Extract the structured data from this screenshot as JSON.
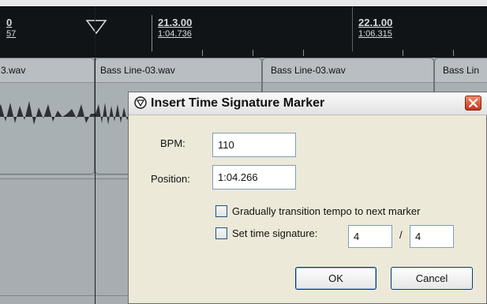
{
  "ruler": {
    "left_bar": "0",
    "left_time": "57",
    "marker1_bar": "21.3.00",
    "marker1_time": "1:04.736",
    "marker2_bar": "22.1.00",
    "marker2_time": "1:06.315"
  },
  "clips": [
    {
      "name": "3.wav"
    },
    {
      "name": "Bass Line-03.wav"
    },
    {
      "name": "Bass Line-03.wav"
    },
    {
      "name": "Bass Lin"
    }
  ],
  "dialog": {
    "title": "Insert Time Signature Marker",
    "bpm_label": "BPM:",
    "bpm_value": "110",
    "position_label": "Position:",
    "position_value": "1:04.266",
    "gradual_label": "Gradually transition tempo to next marker",
    "set_timesig_label": "Set time signature:",
    "timesig_numerator": "4",
    "timesig_separator": "/",
    "timesig_denominator": "4",
    "ok_label": "OK",
    "cancel_label": "Cancel"
  },
  "icons": {
    "dialog_app": "reaper-logo-icon",
    "close": "close-icon",
    "playhead": "playhead-triangle-icon"
  },
  "colors": {
    "ruler_bg": "#111417",
    "dialog_bg": "#ece9d8",
    "close_red": "#c8321a"
  }
}
